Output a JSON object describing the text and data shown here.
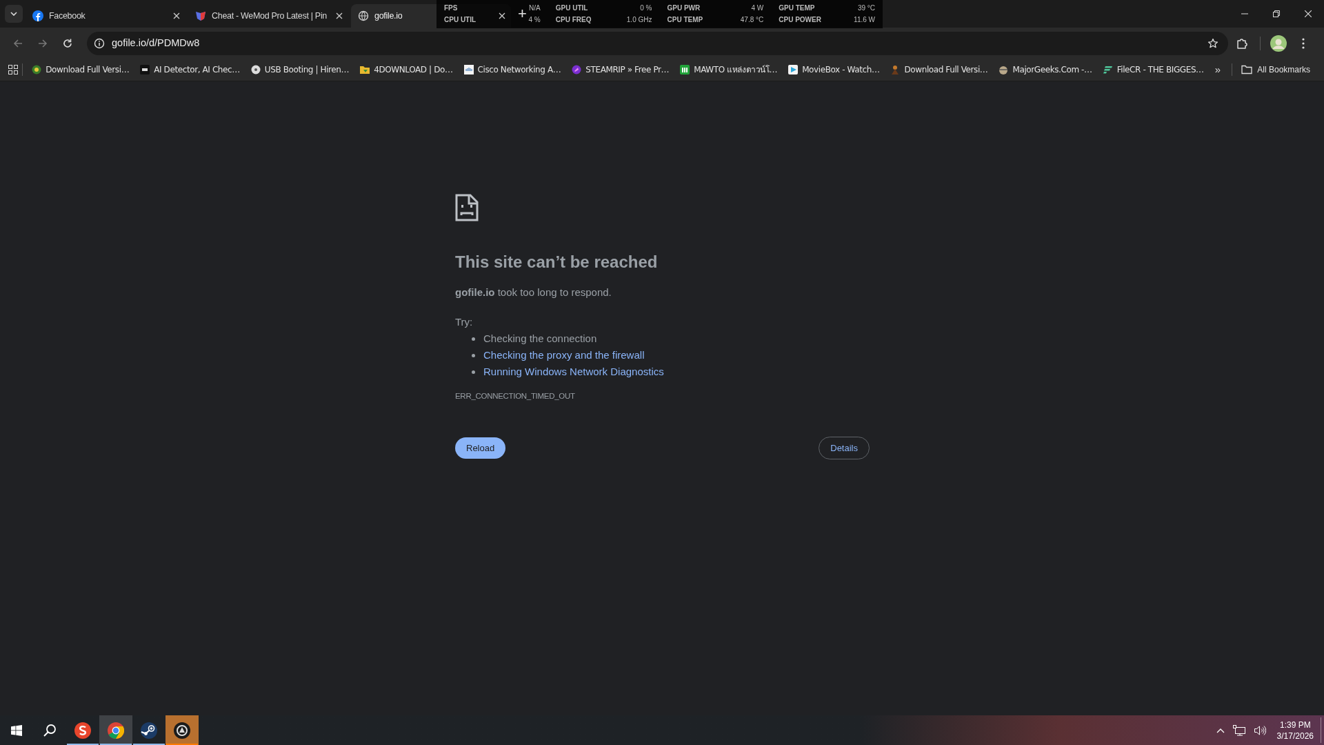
{
  "tabs": [
    {
      "title": "Facebook",
      "selected": false
    },
    {
      "title": "Cheat - WeMod Pro Latest | Pin",
      "selected": false
    },
    {
      "title": "gofile.io",
      "selected": true
    }
  ],
  "new_tab": "+",
  "overlay": [
    {
      "label": "FPS",
      "value": "N/A"
    },
    {
      "label": "GPU UTIL",
      "value": "0 %"
    },
    {
      "label": "GPU PWR",
      "value": "4 W"
    },
    {
      "label": "GPU TEMP",
      "value": "39 °C"
    },
    {
      "label": "CPU UTIL",
      "value": "4 %"
    },
    {
      "label": "CPU FREQ",
      "value": "1.0 GHz"
    },
    {
      "label": "CPU TEMP",
      "value": "47.8 °C"
    },
    {
      "label": "CPU POWER",
      "value": "11.6 W"
    }
  ],
  "address": "gofile.io/d/PDMDw8",
  "bookmarks": [
    {
      "title": "Download Full Versi…"
    },
    {
      "title": "AI Detector, AI Chec…"
    },
    {
      "title": "USB Booting | Hiren…"
    },
    {
      "title": "4DOWNLOAD | Do…"
    },
    {
      "title": "Cisco Networking A…"
    },
    {
      "title": "STEAMRIP » Free Pr…"
    },
    {
      "title": "MAWTO แหล่งดาวน์โ…"
    },
    {
      "title": "MovieBox - Watch…"
    },
    {
      "title": "Download Full Versi…"
    },
    {
      "title": "MajorGeeks.Com -…"
    },
    {
      "title": "FileCR - THE BIGGES…"
    }
  ],
  "more_bookmarks": "»",
  "all_bookmarks": "All Bookmarks",
  "error": {
    "heading": "This site can’t be reached",
    "message": "**gofile.io** took too long to respond.",
    "try": "Try:",
    "suggestions": [
      {
        "text": "Checking the connection",
        "link": false
      },
      {
        "text": "Checking the proxy and the firewall",
        "link": true
      },
      {
        "text": "Running Windows Network Diagnostics",
        "link": true
      }
    ],
    "code": "ERR_CONNECTION_TIMED_OUT",
    "reload": "Reload",
    "details": "Details"
  },
  "taskbar": {
    "apps": [
      {
        "active": false,
        "flashing": false
      },
      {
        "active": true,
        "flashing": false
      },
      {
        "active": false,
        "flashing": false
      },
      {
        "active": false,
        "flashing": true
      }
    ],
    "time": "1:39 PM",
    "date": "3/17/2026"
  }
}
